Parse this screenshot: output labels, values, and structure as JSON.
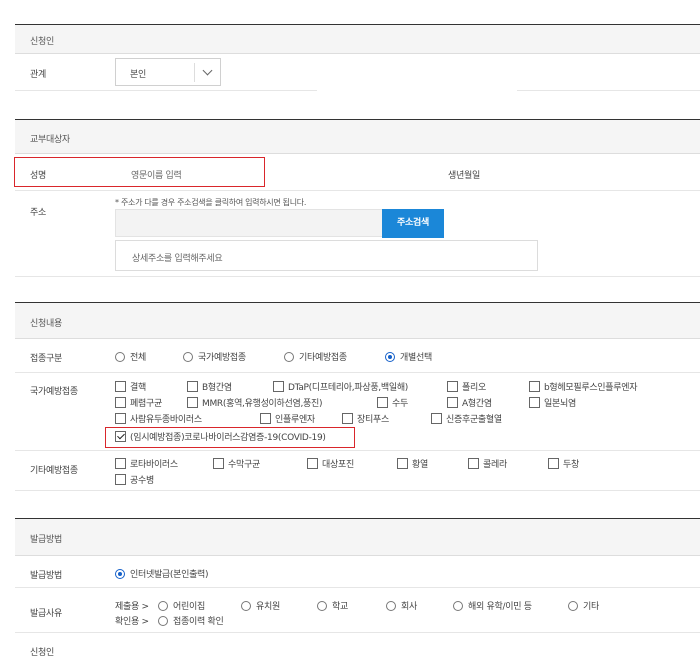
{
  "applicant": {
    "section_title": "신청인",
    "relation_label": "관계",
    "relation_value": "본인"
  },
  "recipient": {
    "section_title": "교부대상자",
    "name_label": "성명",
    "name_placeholder": "영문이름 입력",
    "birth_label": "생년월일",
    "address_label": "주소",
    "address_note": "* 주소가 다를 경우 주소검색을 클릭하여 입력하시면 됩니다.",
    "address_search_button": "주소검색",
    "detail_address_placeholder": "상세주소를 입력해주세요"
  },
  "application": {
    "section_title": "신청내용",
    "type_label": "접종구분",
    "type_options": [
      "전체",
      "국가예방접종",
      "기타예방접종",
      "개별선택"
    ],
    "type_selected": "개별선택",
    "national_label": "국가예방접종",
    "national_items": [
      "결핵",
      "B형간염",
      "DTaP(디프테리아,파상풍,백일해)",
      "폴리오",
      "b형헤모필루스인플루엔자",
      "폐렴구균",
      "MMR(홍역,유행성이하선염,풍진)",
      "수두",
      "A형간염",
      "일본뇌염",
      "사람유두종바이러스",
      "인플루엔자",
      "장티푸스",
      "신증후군출혈열",
      "(임시예방접종)코로나바이러스감염증-19(COVID-19)"
    ],
    "national_checked": "(임시예방접종)코로나바이러스감염증-19(COVID-19)",
    "other_label": "기타예방접종",
    "other_items": [
      "로타바이러스",
      "수막구균",
      "대상포진",
      "황열",
      "콜레라",
      "두창",
      "공수병"
    ]
  },
  "issue": {
    "section_title": "발급방법",
    "method_label": "발급방법",
    "method_option": "인터넷발급(본인출력)",
    "reason_label": "발급사유",
    "submit_prefix": "제출용 >",
    "submit_options": [
      "어린이집",
      "유치원",
      "학교",
      "회사",
      "해외 유학/이민 등",
      "기타"
    ],
    "confirm_prefix": "확인용 >",
    "confirm_option": "접종이력 확인",
    "applicant_label": "신청인"
  },
  "colors": {
    "accent_blue": "#1b87d8",
    "highlight_red": "#d9262b",
    "radio_blue": "#1560c9"
  }
}
